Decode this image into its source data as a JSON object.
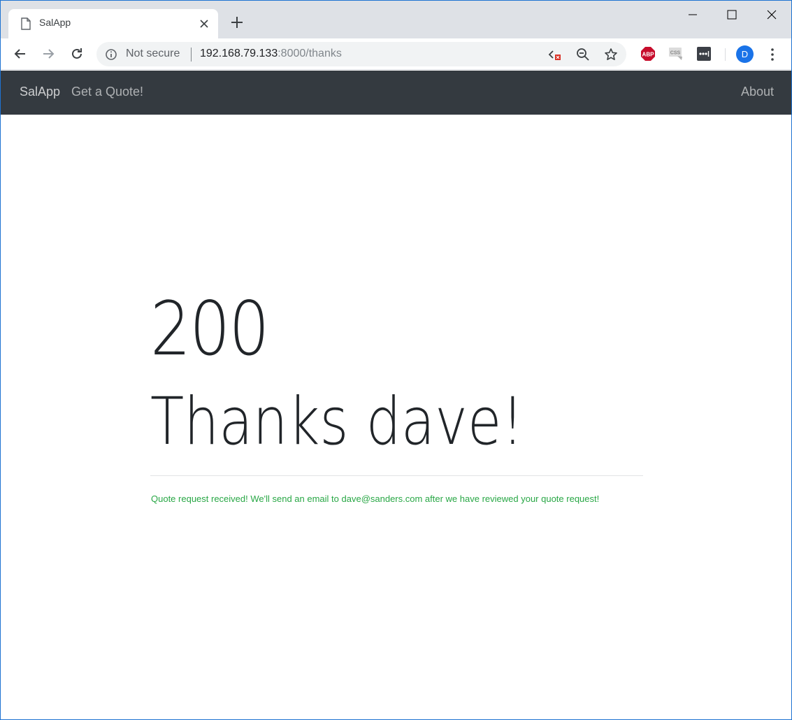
{
  "browser": {
    "tab_title": "SalApp",
    "omnibox": {
      "security_label": "Not secure",
      "url_host": "192.168.79.133",
      "url_path": ":8000/thanks"
    },
    "profile_initial": "D",
    "extensions": [
      "adblock-plus",
      "css-viewer",
      "password-manager"
    ]
  },
  "navbar": {
    "brand": "SalApp",
    "links": {
      "quote": "Get a Quote!",
      "about": "About"
    }
  },
  "main": {
    "status_code": "200",
    "heading": "Thanks dave!",
    "message": "Quote request received! We'll send an email to dave@sanders.com after we have reviewed your quote request!"
  },
  "colors": {
    "navbar_bg": "#343a40",
    "success_text": "#28a745",
    "heading_text": "#212529",
    "tabstrip_bg": "#dee1e6"
  }
}
